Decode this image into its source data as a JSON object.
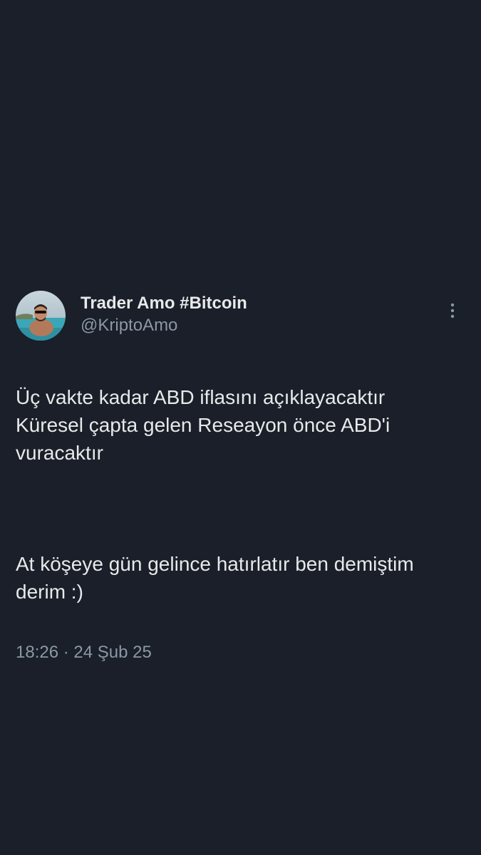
{
  "tweet": {
    "author": {
      "display_name": "Trader Amo #Bitcoin",
      "handle": "@KriptoAmo",
      "avatar_icon": "profile-photo"
    },
    "more_icon": "vertical-ellipsis-icon",
    "text_paragraphs": [
      "Üç vakte kadar ABD iflasını açıklayacaktır\nKüresel çapta gelen Reseayon önce ABD'i vuracaktır",
      "At köşeye gün gelince hatırlatır ben demiştim derim :)"
    ],
    "time": "18:26",
    "separator": "·",
    "date": "24 Şub 25"
  },
  "colors": {
    "background": "#1a1f29",
    "primary_text": "#e7e9ea",
    "secondary_text": "#8b98a5"
  }
}
